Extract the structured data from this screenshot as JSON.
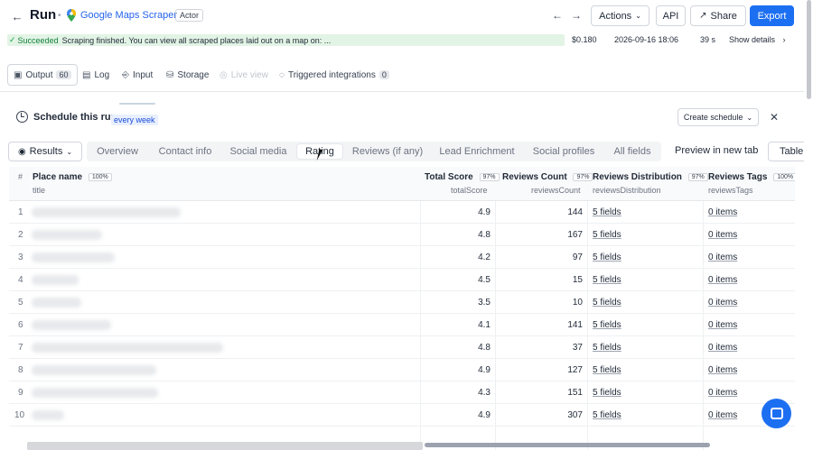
{
  "header": {
    "title": "Run",
    "actor_name": "Google Maps Scraper",
    "actor_badge": "Actor",
    "back_icon": "arrow-left-icon",
    "buttons": {
      "actions": "Actions",
      "api": "API",
      "share": "Share",
      "export": "Export"
    }
  },
  "status": {
    "state": "Succeeded",
    "message": "Scraping finished. You can view all scraped places laid out on a map on: ...",
    "cost": "$0.180",
    "started": "2026-09-16 18:06",
    "duration": "39 s",
    "details_label": "Show details"
  },
  "output_tabs": [
    {
      "label": "Output",
      "count": "60"
    },
    {
      "label": "Log"
    },
    {
      "label": "Input"
    },
    {
      "label": "Storage"
    },
    {
      "label": "Live view"
    },
    {
      "label": "Triggered integrations",
      "count": "0"
    }
  ],
  "schedule": {
    "title": "Schedule this run",
    "frequency": "every week",
    "create_label": "Create schedule"
  },
  "view": {
    "results_label": "Results",
    "tabs": [
      "Overview",
      "Contact info",
      "Social media",
      "Rating",
      "Reviews (if any)",
      "Lead Enrichment",
      "Social profiles",
      "All fields"
    ],
    "active_tab": "Rating",
    "preview_label": "Preview in new tab",
    "table_label": "Table"
  },
  "table": {
    "columns": [
      {
        "title": "#"
      },
      {
        "title": "Place name",
        "pct": "100%",
        "field": "title"
      },
      {
        "title": "Total Score",
        "pct": "97%",
        "field": "totalScore"
      },
      {
        "title": "Reviews Count",
        "pct": "97%",
        "field": "reviewsCount"
      },
      {
        "title": "Reviews Distribution",
        "pct": "97%",
        "field": "reviewsDistribution"
      },
      {
        "title": "Reviews Tags",
        "pct": "100%",
        "field": "reviewsTags"
      }
    ],
    "rows": [
      {
        "idx": "1",
        "score": "4.9",
        "count": "144",
        "dist": "5 fields",
        "tags": "0 items"
      },
      {
        "idx": "2",
        "score": "4.8",
        "count": "167",
        "dist": "5 fields",
        "tags": "0 items"
      },
      {
        "idx": "3",
        "score": "4.2",
        "count": "97",
        "dist": "5 fields",
        "tags": "0 items"
      },
      {
        "idx": "4",
        "score": "4.5",
        "count": "15",
        "dist": "5 fields",
        "tags": "0 items"
      },
      {
        "idx": "5",
        "score": "3.5",
        "count": "10",
        "dist": "5 fields",
        "tags": "0 items"
      },
      {
        "idx": "6",
        "score": "4.1",
        "count": "141",
        "dist": "5 fields",
        "tags": "0 items"
      },
      {
        "idx": "7",
        "score": "4.8",
        "count": "37",
        "dist": "5 fields",
        "tags": "0 items"
      },
      {
        "idx": "8",
        "score": "4.9",
        "count": "127",
        "dist": "5 fields",
        "tags": "0 items"
      },
      {
        "idx": "9",
        "score": "4.3",
        "count": "151",
        "dist": "5 fields",
        "tags": "0 items"
      },
      {
        "idx": "10",
        "score": "4.9",
        "count": "307",
        "dist": "5 fields",
        "tags": "0 items"
      }
    ]
  },
  "colors": {
    "accent": "#1d6ff2",
    "success_bg": "#e2f4e5",
    "success_text": "#15803d"
  }
}
